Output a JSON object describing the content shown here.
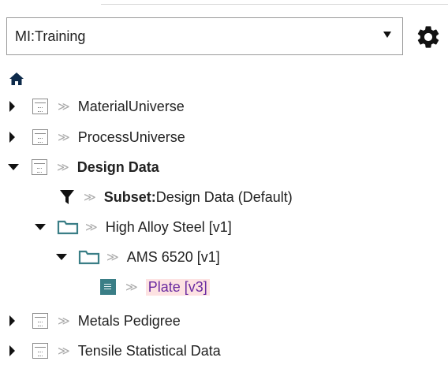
{
  "database_selector": {
    "value": "MI:Training",
    "caret_icon": "dropdown-caret-icon"
  },
  "settings": {
    "icon": "gear-icon"
  },
  "home": {
    "icon": "home-icon"
  },
  "tree": {
    "items": [
      {
        "label": "MaterialUniverse",
        "expanded": false,
        "icon": "table-icon"
      },
      {
        "label": "ProcessUniverse",
        "expanded": false,
        "icon": "table-icon"
      },
      {
        "label": "Design Data",
        "expanded": true,
        "icon": "table-icon",
        "bold": true
      },
      {
        "prefix": "Subset:",
        "label": "Design Data (Default)",
        "icon": "filter-icon"
      },
      {
        "label": "High Alloy Steel [v1]",
        "expanded": true,
        "icon": "folder-icon"
      },
      {
        "label": "AMS 6520 [v1]",
        "expanded": true,
        "icon": "folder-icon"
      },
      {
        "label": "Plate [v3]",
        "icon": "record-icon",
        "selected": true
      },
      {
        "label": "Metals Pedigree",
        "expanded": false,
        "icon": "table-icon"
      },
      {
        "label": "Tensile Statistical Data",
        "expanded": false,
        "icon": "table-icon"
      }
    ],
    "chevron_glyph": "≫"
  },
  "colors": {
    "folder_teal": "#3a7e86",
    "selection_bg": "#fde2e2",
    "selection_text": "#6a2aa0"
  }
}
